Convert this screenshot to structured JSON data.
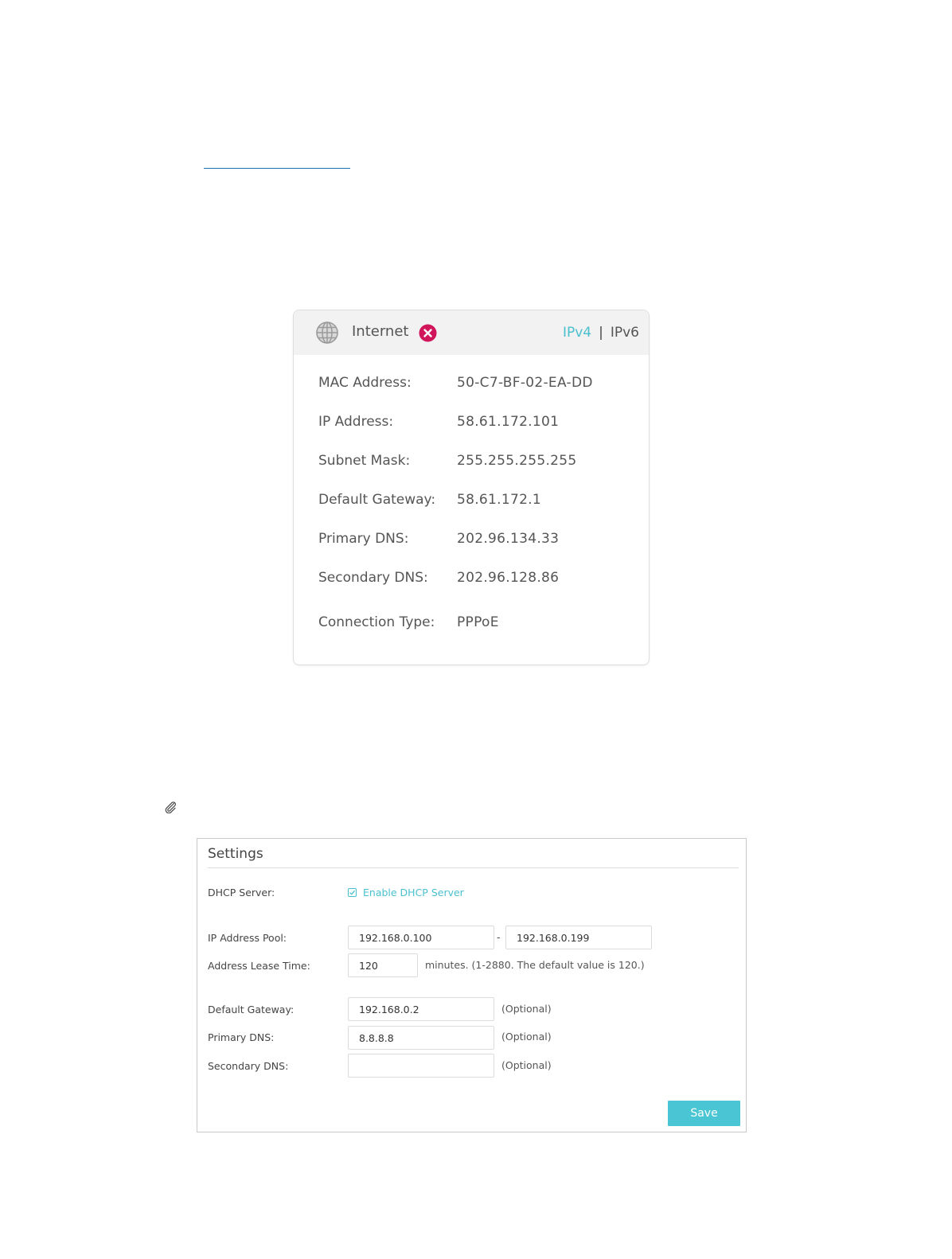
{
  "status": {
    "title": "Internet",
    "ipv4_label": "IPv4",
    "separator": "|",
    "ipv6_label": "IPv6",
    "accent_color": "#4ac0cf",
    "error_color": "#d0155b",
    "rows": [
      {
        "label": "MAC Address:",
        "value": "50-C7-BF-02-EA-DD"
      },
      {
        "label": "IP Address:",
        "value": "58.61.172.101"
      },
      {
        "label": "Subnet Mask:",
        "value": "255.255.255.255"
      },
      {
        "label": "Default Gateway:",
        "value": "58.61.172.1"
      },
      {
        "label": "Primary DNS:",
        "value": "202.96.134.33"
      },
      {
        "label": "Secondary DNS:",
        "value": "202.96.128.86"
      },
      {
        "label": "Connection Type:",
        "value": "PPPoE"
      }
    ]
  },
  "settings": {
    "title": "Settings",
    "dhcp_label": "DHCP Server:",
    "dhcp_checkbox_label": "Enable DHCP Server",
    "dhcp_enabled": true,
    "pool_label": "IP Address Pool:",
    "pool_start": "192.168.0.100",
    "pool_dash": "-",
    "pool_end": "192.168.0.199",
    "lease_label": "Address Lease Time:",
    "lease_value": "120",
    "lease_hint": "minutes. (1-2880. The default value is 120.)",
    "gateway_label": "Default Gateway:",
    "gateway_value": "192.168.0.2",
    "primary_dns_label": "Primary DNS:",
    "primary_dns_value": "8.8.8.8",
    "secondary_dns_label": "Secondary DNS:",
    "secondary_dns_value": "",
    "optional_hint": "(Optional)",
    "save_label": "Save",
    "save_color": "#4ac5d3"
  }
}
